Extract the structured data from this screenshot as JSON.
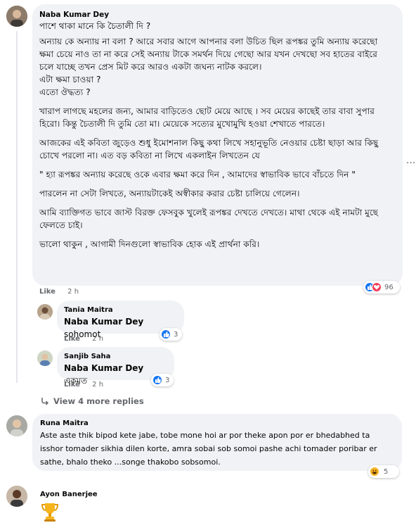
{
  "comments": [
    {
      "author": "Naba Kumar Dey",
      "paragraphs": [
        "পাশে থাকা মানে কি চৈতালী দি ?",
        "অন্যায় কে অন্যায় না বলা ? আরে সবার আগে আপনার বলা উচিত ছিল রূপঙ্কর তুমি অন্যায় করেছো ক্ষমা চেয়ে নাও তা না করে সেই অন্যায় টাকে সমর্থন দিয়ে গেছো আর যখন দেখছো সব হাতের বাইরে চলে যাচ্ছে তখন প্রেস মিট করে আরও একটা জঘন্য নাটক করলে।\nএটা ক্ষমা চাওয়া ?\nএতো ঔদ্ধত্য ?",
        "খারাপ লাগছে মহলের জন্য, আমার বাড়িতেও ছোট মেয়ে আছে । সব মেয়ের কাছেই তার বাবা সুপার হিরো। কিন্তু চৈতালী দি তুমি তো মা। মেয়েকে সত্যের মুখোমুখি হওয়া শেখাতে পারতে।",
        "আজকের এই কবিতা জুড়েও শুধু ইমোশনাল কিছু কথা লিখে সহানুভূতি নেওয়ার চেষ্টা ছাড়া আর কিছু চোখে পরলো না। এত বড় কবিতা না লিখে একলাইন লিখতেন যে",
        "\" হ্যা রূপঙ্কর অন্যায় করেছে ওকে এবার ক্ষমা করে দিন , আমাদের স্বাভাবিক ভাবে বাঁচতে দিন \"",
        "পারলেন না সেটা লিখতে, অন্যায়টাকেই অস্বীকার করার চেষ্টা চালিয়ে গেলেন।",
        "আমি ব্যাক্তিগত ভাবে জাস্ট বিরক্ত ফেসবুক খুলেই রূপঙ্কর দেখতে দেখতে। মাথা থেকে এই নামটা মুছে ফেলতে চাই।",
        "ভালো থাকুন , আগামী দিনগুলো স্বাভাবিক হোক এই প্রার্থনা করি।"
      ],
      "like_label": "Like",
      "time": "2 h",
      "reaction_count": "96",
      "reactions": [
        "like-icon",
        "love-icon"
      ]
    }
  ],
  "replies": [
    {
      "author": "Tania Maitra",
      "mention": "Naba Kumar Dey",
      "text": " sohomot",
      "like_label": "Like",
      "time": "2 h",
      "reaction_count": "3"
    },
    {
      "author": "Sanjib Saha",
      "mention": "Naba Kumar Dey",
      "text": " একমত",
      "like_label": "Like",
      "time": "2 h",
      "reaction_count": "3"
    }
  ],
  "view_more": "View 4 more replies",
  "comment2": {
    "author": "Runa Maitra",
    "text": "Aste aste thik bipod kete jabe, tobe mone hoi ar por theke apon por er bhedabhed ta isshor tomader sikhia dilen korte, amra sobai sob somoi pashe achi tomader poribar er sathe, bhalo theko ...songe thakobo sobsomoi.",
    "reaction_count": "5",
    "reactions": [
      "haha-icon"
    ]
  },
  "comment3": {
    "author": "Ayon Banerjee",
    "content_icon": "trophy-icon"
  },
  "side_menu": "···"
}
